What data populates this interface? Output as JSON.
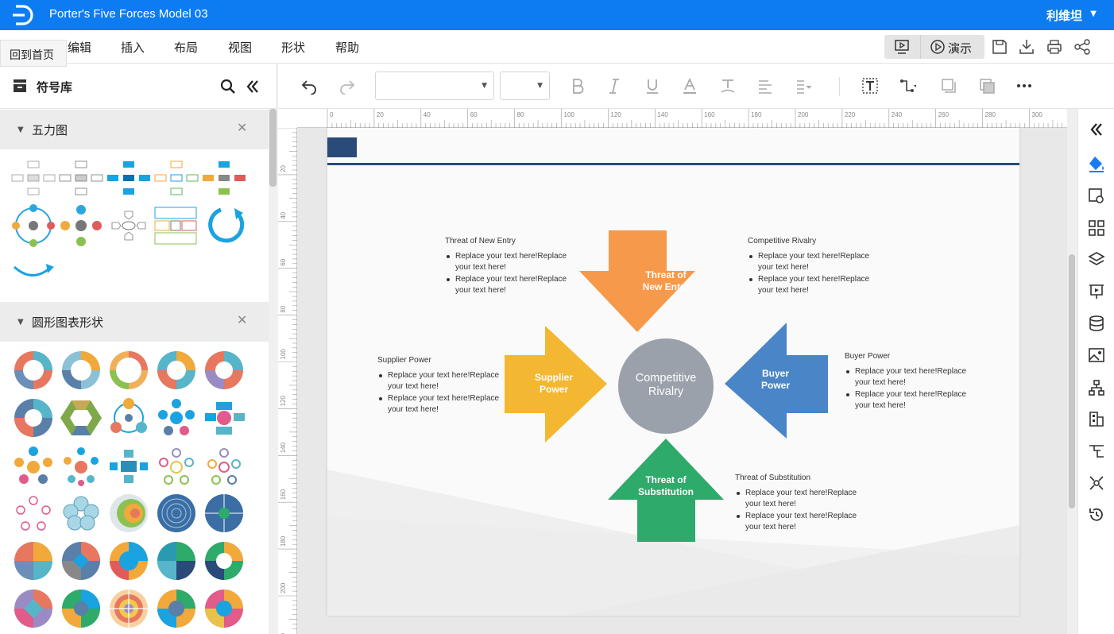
{
  "app": {
    "document_title": "Porter's Five Forces Model 03",
    "user_name": "利维坦"
  },
  "menu": {
    "home_tooltip": "回到首页",
    "items": [
      "编辑",
      "插入",
      "布局",
      "视图",
      "形状",
      "帮助"
    ],
    "present_label": "演示"
  },
  "library": {
    "title": "符号库",
    "sections": [
      {
        "label": "五力图"
      },
      {
        "label": "圆形图表形状"
      }
    ]
  },
  "ruler": {
    "h_ticks": [
      "0",
      "20",
      "40",
      "60",
      "80",
      "100",
      "120",
      "140",
      "160",
      "180",
      "200",
      "220",
      "240",
      "260",
      "280",
      "300"
    ],
    "v_ticks": [
      "20",
      "40",
      "60",
      "80",
      "100",
      "120",
      "140",
      "160",
      "180",
      "200",
      "20"
    ]
  },
  "diagram": {
    "center": {
      "line1": "Competitive",
      "line2": "Rivalry",
      "color": "#9aa1ab"
    },
    "arrows": {
      "top": {
        "line1": "Threat of",
        "line2": "New Entry",
        "color": "#f7994a"
      },
      "left": {
        "line1": "Supplier",
        "line2": "Power",
        "color": "#f4b731"
      },
      "right": {
        "line1": "Buyer",
        "line2": "Power",
        "color": "#4a86c7"
      },
      "bottom": {
        "line1": "Threat of",
        "line2": "Substitution",
        "color": "#2eaa6a"
      }
    },
    "blocks": {
      "new_entry": {
        "title": "Threat of New Entry",
        "items": [
          "Replace your text here!Replace your text here!",
          "Replace your text here!Replace your text here!"
        ]
      },
      "rivalry": {
        "title": "Competitive Rivalry",
        "items": [
          "Replace your text here!Replace your text here!",
          "Replace your text here!Replace your text here!"
        ]
      },
      "supplier": {
        "title": "Supplier Power",
        "items": [
          "Replace your text here!Replace your text here!",
          "Replace your text here!Replace your text here!"
        ]
      },
      "buyer": {
        "title": "Buyer Power",
        "items": [
          "Replace your text here!Replace your text here!",
          "Replace your text here!Replace your text here!"
        ]
      },
      "substitution": {
        "title": "Threat of Substitution",
        "items": [
          "Replace your text here!Replace your text here!",
          "Replace your text here!Replace your text here!"
        ]
      }
    },
    "header_color": "#2a4a7a"
  },
  "colors": {
    "brand": "#0d7cf2",
    "accent_icon": "#1a7cf0"
  }
}
